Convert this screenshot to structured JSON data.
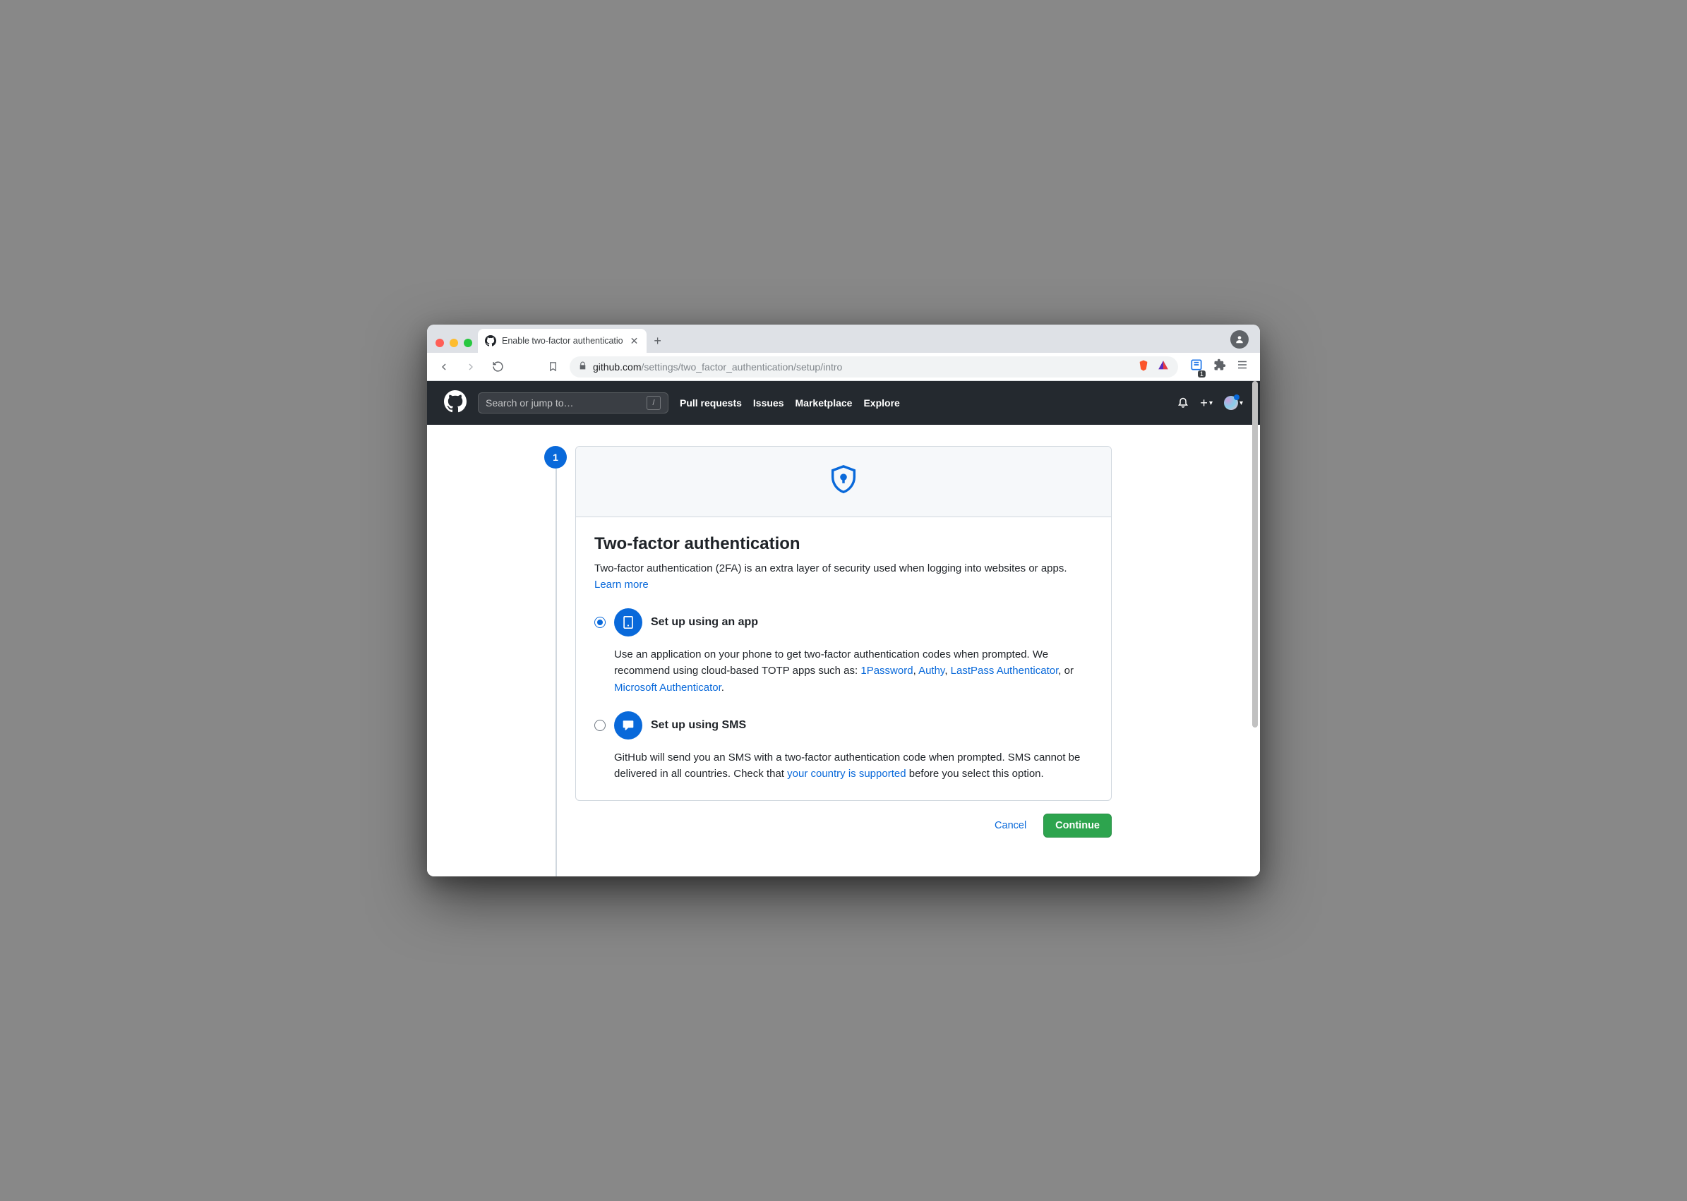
{
  "browser": {
    "tab_title": "Enable two-factor authenticatio",
    "new_tab": "+",
    "url_domain": "github.com",
    "url_path": "/settings/two_factor_authentication/setup/intro",
    "search_slash": "/"
  },
  "gh": {
    "search_placeholder": "Search or jump to…",
    "nav": {
      "pulls": "Pull requests",
      "issues": "Issues",
      "marketplace": "Marketplace",
      "explore": "Explore"
    },
    "plus": "+",
    "caret": "▾"
  },
  "page": {
    "step_number": "1",
    "heading": "Two-factor authentication",
    "intro_a": "Two-factor authentication (2FA) is an extra layer of security used when logging into websites or apps. ",
    "learn_more": "Learn more",
    "opt_app": {
      "title": "Set up using an app",
      "desc_a": "Use an application on your phone to get two-factor authentication codes when prompted. We recommend using cloud-based TOTP apps such as: ",
      "link1": "1Password",
      "sep1": ", ",
      "link2": "Authy",
      "sep2": ", ",
      "link3": "LastPass Authenticator",
      "sep3": ", or ",
      "link4": "Microsoft Authenticator",
      "tail": "."
    },
    "opt_sms": {
      "title": "Set up using SMS",
      "desc_a": "GitHub will send you an SMS with a two-factor authentication code when prompted. SMS cannot be delivered in all countries. Check that ",
      "link": "your country is supported",
      "desc_b": " before you select this option."
    },
    "cancel": "Cancel",
    "continue": "Continue"
  }
}
